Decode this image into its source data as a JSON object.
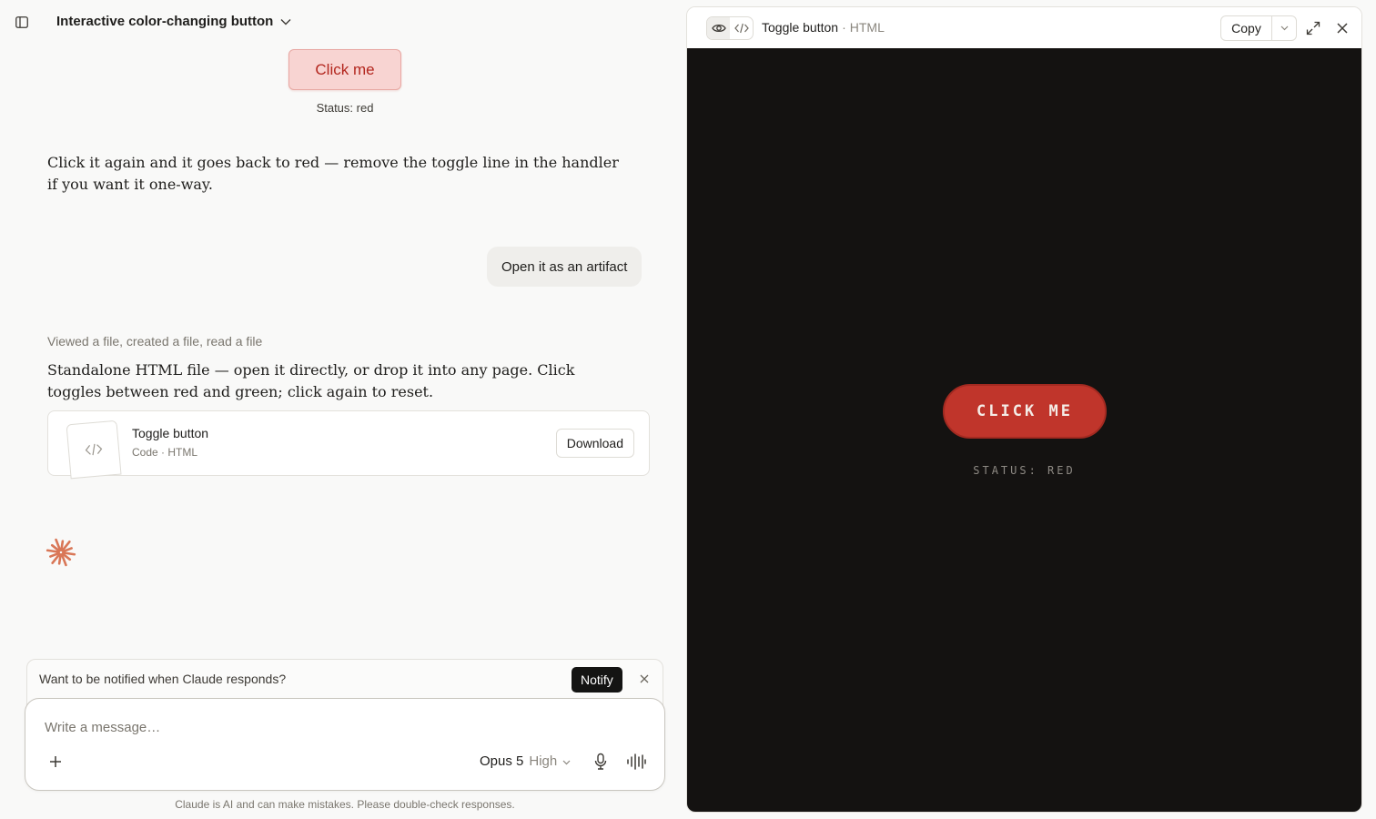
{
  "header": {
    "chat_title": "Interactive color-changing button",
    "icons": {
      "sidebar": "sidebar-toggle-icon",
      "title_menu": "chevron-down-icon"
    }
  },
  "conversation": {
    "demo_button_label": "Click me",
    "demo_status": "Status: red",
    "assistant_message_1": "Click it again and it goes back to red — remove the toggle line in the handler if you want it one-way.",
    "user_message": "Open it as an artifact",
    "tool_summary": "Viewed a file, created a file, read a file",
    "assistant_message_2": "Standalone HTML file — open it directly, or drop it into any page. Click toggles between red and green; click again to reset.",
    "artifact_card": {
      "name": "Toggle button",
      "meta": "Code · HTML",
      "download_label": "Download"
    }
  },
  "notify": {
    "text": "Want to be notified when Claude responds?",
    "button_label": "Notify"
  },
  "composer": {
    "placeholder": "Write a message…",
    "model": "Opus 5",
    "effort": "High"
  },
  "disclaimer": "Claude is AI and can make mistakes. Please double-check responses.",
  "artifact_panel": {
    "title": "Toggle button",
    "separator": "·",
    "language": "HTML",
    "copy_label": "Copy",
    "active_view": "preview",
    "preview": {
      "button_label": "CLICK ME",
      "status_text": "STATUS: RED"
    }
  },
  "colors": {
    "accent_orange": "#d97757",
    "preview_bg": "#141211",
    "preview_button": "#c0352b",
    "demo_button_bg": "#f8d4d2",
    "demo_button_text": "#b3261e"
  }
}
